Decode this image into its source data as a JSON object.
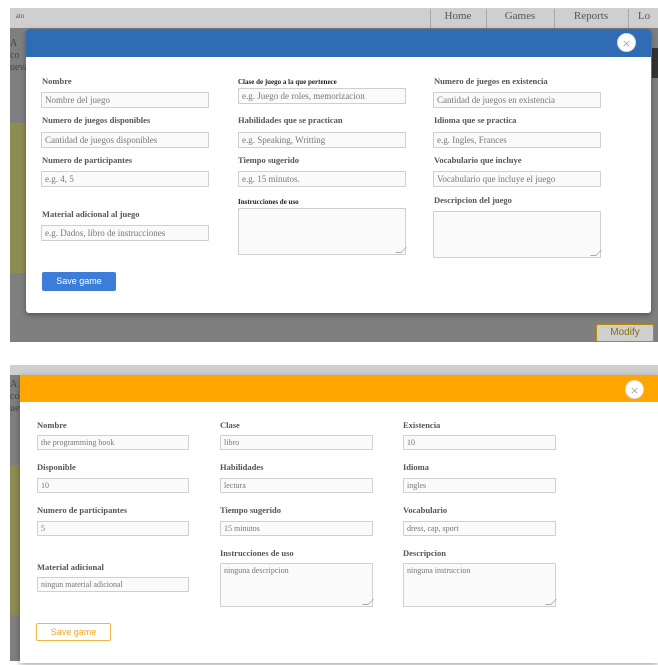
{
  "background": {
    "nav": [
      "Home",
      "Games",
      "Reports",
      "Lo"
    ],
    "nav_left_text": "ato",
    "side_text": [
      "A co",
      "ueva"
    ],
    "modify_label": "Modify"
  },
  "modal_blue": {
    "header_color": "#2f6cb4",
    "close_icon": "×",
    "fields": {
      "nombre": {
        "label": "Nombre",
        "placeholder": "Nombre del juego"
      },
      "clase": {
        "label": "Clase de juego a la que pertenece",
        "placeholder": "e.g. Juego de roles, memorizacion"
      },
      "existencia": {
        "label": "Numero de juegos en existencia",
        "placeholder": "Cantidad de juegos en existencia"
      },
      "disponibles": {
        "label": "Numero de juegos disponibles",
        "placeholder": "Cantidad de juegos disponibles"
      },
      "habilidades": {
        "label": "Habilidades que se practican",
        "placeholder": "e.g. Speaking, Writting"
      },
      "idioma": {
        "label": "Idioma que se practica",
        "placeholder": "e.g. Ingles, Frances"
      },
      "participantes": {
        "label": "Numero de participantes",
        "placeholder": "e.g. 4, 5"
      },
      "tiempo": {
        "label": "Tiempo sugerido",
        "placeholder": "e.g. 15 minutos."
      },
      "vocabulario": {
        "label": "Vocabulario que incluye",
        "placeholder": "Vocabulario que incluye el juego"
      },
      "material": {
        "label": "Material adicional al juego",
        "placeholder": "e.g.  Dados, libro de instrucciones"
      },
      "instrucciones": {
        "label": "Instrucciones de uso",
        "value": ""
      },
      "descripcion": {
        "label": "Descripcion del juego",
        "value": ""
      }
    },
    "save_label": "Save game"
  },
  "modal_orange": {
    "header_color": "#ffa500",
    "close_icon": "×",
    "fields": {
      "nombre": {
        "label": "Nombre",
        "value": "the programming book"
      },
      "clase": {
        "label": "Clase",
        "value": "libro"
      },
      "existencia": {
        "label": "Existencia",
        "value": "10"
      },
      "disponible": {
        "label": "Disponible",
        "value": "10"
      },
      "habilidades": {
        "label": "Habilidades",
        "value": "lectura"
      },
      "idioma": {
        "label": "Idioma",
        "value": "ingles"
      },
      "participantes": {
        "label": "Numero de participantes",
        "value": "5"
      },
      "tiempo": {
        "label": "Tiempo sugerido",
        "value": "15 minutos"
      },
      "vocabulario": {
        "label": "Vocabulario",
        "value": "dress, cap, sport"
      },
      "material": {
        "label": "Material adicional",
        "value": "ningun material adicional"
      },
      "instrucciones": {
        "label": "Instrucciones de uso",
        "value": "ninguna descripcion"
      },
      "descripcion": {
        "label": "Descripcion",
        "value": "ninguna instruccion"
      }
    },
    "save_label": "Save game"
  }
}
